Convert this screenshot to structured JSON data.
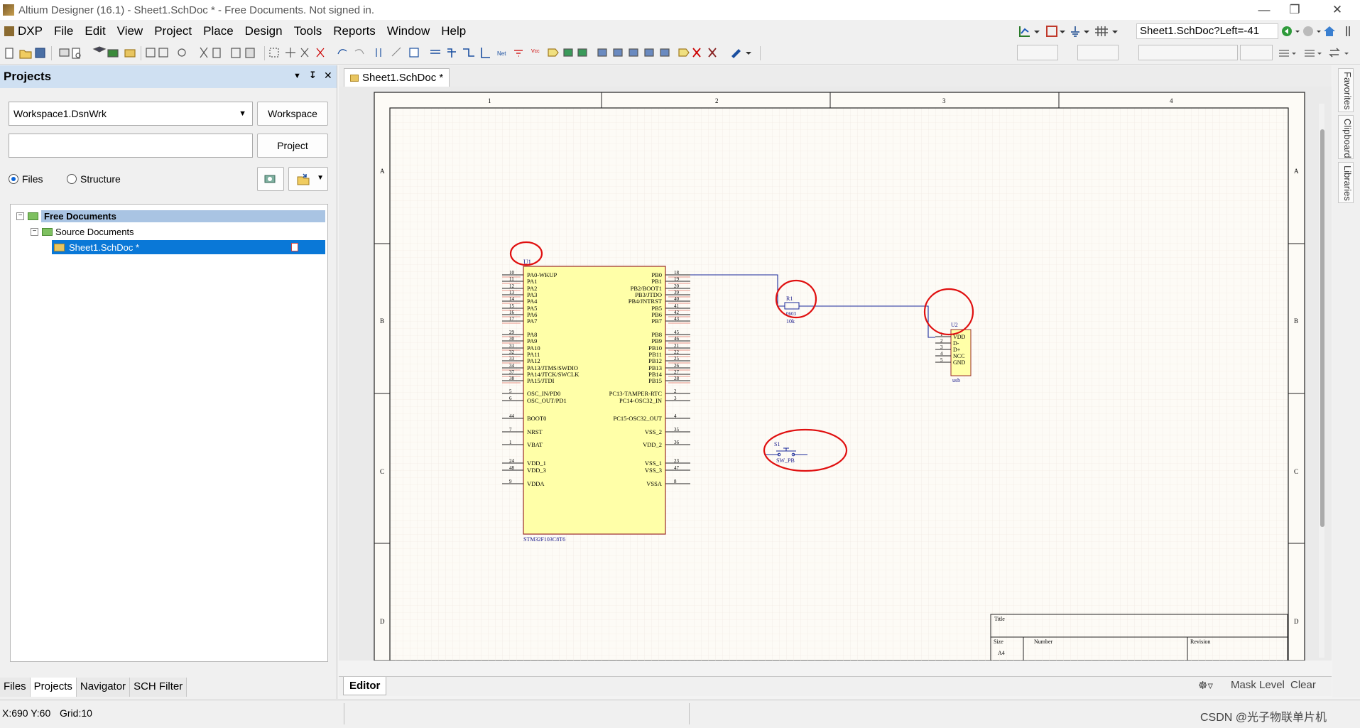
{
  "window": {
    "title": "Altium Designer (16.1) - Sheet1.SchDoc * - Free Documents. Not signed in."
  },
  "menu": [
    "DXP",
    "File",
    "Edit",
    "View",
    "Project",
    "Place",
    "Design",
    "Tools",
    "Reports",
    "Window",
    "Help"
  ],
  "address": "Sheet1.SchDoc?Left=-41",
  "projects_panel": {
    "title": "Projects",
    "workspace_value": "Workspace1.DsnWrk",
    "workspace_button": "Workspace",
    "project_button": "Project",
    "radio_files": "Files",
    "radio_structure": "Structure",
    "tree": {
      "root": "Free Documents",
      "group": "Source Documents",
      "doc": "Sheet1.SchDoc *"
    }
  },
  "bottom_tabs": [
    "Files",
    "Projects",
    "Navigator",
    "SCH Filter"
  ],
  "doc_tab": "Sheet1.SchDoc *",
  "editor_tab": "Editor",
  "editor_right": {
    "mask": "Mask Level",
    "clear": "Clear"
  },
  "right_panels": [
    "Favorites",
    "Clipboard",
    "Libraries"
  ],
  "status": {
    "coords": "X:690 Y:60",
    "grid": "Grid:10",
    "watermark": "CSDN @光子物联单片机"
  },
  "sheet": {
    "cols": [
      "1",
      "2",
      "3",
      "4"
    ],
    "rows": [
      "A",
      "B",
      "C",
      "D"
    ],
    "title_block": {
      "title": "Title",
      "size": "Size",
      "size_val": "A4",
      "number": "Number",
      "revision": "Revision"
    }
  },
  "u1": {
    "ref": "U1",
    "part": "STM32F103C8T6",
    "left_pins": [
      "PA0-WKUP",
      "PA1",
      "PA2",
      "PA3",
      "PA4",
      "PA5",
      "PA6",
      "PA7",
      "PA8",
      "PA9",
      "PA10",
      "PA11",
      "PA12",
      "PA13/JTMS/SWDIO",
      "PA14/JTCK/SWCLK",
      "PA15/JTDI",
      "OSC_IN/PD0",
      "OSC_OUT/PD1",
      "BOOT0",
      "NRST",
      "VBAT",
      "VDD_1",
      "VDD_3",
      "VDDA"
    ],
    "right_pins": [
      "PB0",
      "PB1",
      "PB2/BOOT1",
      "PB3/JTDO",
      "PB4/JNTRST",
      "PB5",
      "PB6",
      "PB7",
      "PB8",
      "PB9",
      "PB10",
      "PB11",
      "PB12",
      "PB13",
      "PB14",
      "PB15",
      "PC13-TAMPER-RTC",
      "PC14-OSC32_IN",
      "PC15-OSC32_OUT",
      "VSS_2",
      "VDD_2",
      "VSS_1",
      "VSS_3",
      "VSSA"
    ],
    "left_nums": [
      "10",
      "11",
      "12",
      "13",
      "14",
      "15",
      "16",
      "17",
      "29",
      "30",
      "31",
      "32",
      "33",
      "34",
      "37",
      "38",
      "5",
      "6",
      "44",
      "7",
      "1",
      "24",
      "48",
      "9"
    ],
    "right_nums": [
      "18",
      "19",
      "20",
      "39",
      "40",
      "41",
      "42",
      "43",
      "45",
      "46",
      "21",
      "22",
      "25",
      "26",
      "27",
      "28",
      "2",
      "3",
      "4",
      "35",
      "36",
      "23",
      "47",
      "8"
    ]
  },
  "r1": {
    "ref": "R1",
    "footprint": "0603",
    "value": "10k"
  },
  "u2": {
    "ref": "U2",
    "part": "usb",
    "pins": [
      "VDD",
      "D-",
      "D+",
      "NCC",
      "GND"
    ],
    "nums": [
      "1",
      "2",
      "3",
      "4",
      "5"
    ]
  },
  "s1": {
    "ref": "S1",
    "part": "SW_PB"
  }
}
